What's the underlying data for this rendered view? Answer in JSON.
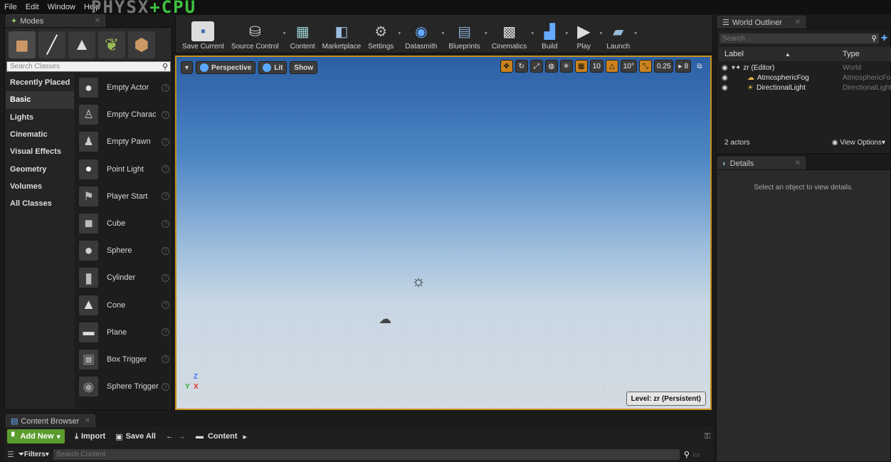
{
  "menu": [
    "File",
    "Edit",
    "Window",
    "Help"
  ],
  "logo_text": "PHYSX+CPU",
  "modes": {
    "tab_label": "Modes",
    "search_placeholder": "Search Classes",
    "categories": [
      "Recently Placed",
      "Basic",
      "Lights",
      "Cinematic",
      "Visual Effects",
      "Geometry",
      "Volumes",
      "All Classes"
    ],
    "active_category": "Basic",
    "classes": [
      "Empty Actor",
      "Empty Charact",
      "Empty Pawn",
      "Point Light",
      "Player Start",
      "Cube",
      "Sphere",
      "Cylinder",
      "Cone",
      "Plane",
      "Box Trigger",
      "Sphere Trigger"
    ]
  },
  "toolbar": {
    "buttons": [
      "Save Current",
      "Source Control",
      "Content",
      "Marketplace",
      "Settings",
      "Datasmith",
      "Blueprints",
      "Cinematics",
      "Build",
      "Play",
      "Launch"
    ]
  },
  "viewport": {
    "perspective": "Perspective",
    "lit": "Lit",
    "show": "Show",
    "grid_snap": "10",
    "rotation_snap": "10°",
    "scale_snap": "0.25",
    "camera_speed": "8",
    "level": "Level:  zr (Persistent)",
    "axis_z": "Z",
    "axis_x": "X",
    "axis_y": "Y"
  },
  "world_outliner": {
    "tab_label": "World Outliner",
    "search_placeholder": "Search...",
    "col_label": "Label",
    "col_type": "Type",
    "rows": [
      {
        "label": "zr (Editor)",
        "type": "World"
      },
      {
        "label": "AtmosphericFog",
        "type": "AtmosphericFog"
      },
      {
        "label": "DirectionalLight",
        "type": "DirectionalLight"
      }
    ],
    "count": "2 actors",
    "view_options": "View Options"
  },
  "details": {
    "tab_label": "Details",
    "empty_message": "Select an object to view details."
  },
  "content_browser": {
    "tab_label": "Content Browser",
    "add_new": "Add New",
    "import": "Import",
    "save_all": "Save All",
    "path": "Content",
    "filters": "Filters",
    "search_placeholder": "Search Content"
  },
  "colors": {
    "viewport_border": "#c98f1e",
    "add_new_green": "#5c9c2e",
    "logo_green": "#3ec43e"
  }
}
